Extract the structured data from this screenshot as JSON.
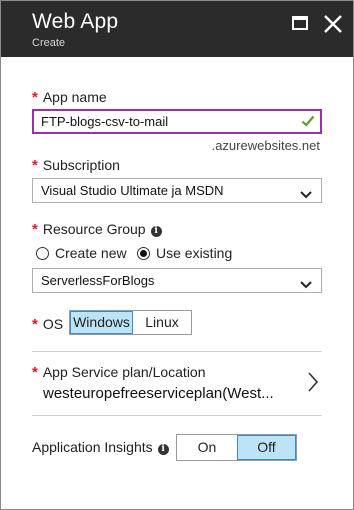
{
  "header": {
    "title": "Web App",
    "subtitle": "Create"
  },
  "icons": {
    "maximize": "maximize-icon",
    "close": "close-icon",
    "check": "check-icon",
    "chevron_down": "chevron-down-icon",
    "chevron_right": "chevron-right-icon",
    "info": "info-icon"
  },
  "required_marker": "*",
  "app_name": {
    "label": "App name",
    "value": "FTP-blogs-csv-to-mail",
    "suffix": ".azurewebsites.net"
  },
  "subscription": {
    "label": "Subscription",
    "value": "Visual Studio Ultimate ja MSDN"
  },
  "resource_group": {
    "label": "Resource Group",
    "info_glyph": "i",
    "options": {
      "create_new": "Create new",
      "use_existing": "Use existing"
    },
    "selected": "use_existing",
    "value": "ServerlessForBlogs"
  },
  "os": {
    "label": "OS",
    "options": [
      "Windows",
      "Linux"
    ],
    "selected": "Windows"
  },
  "app_service_plan": {
    "label": "App Service plan/Location",
    "value": "westeuropefreeserviceplan(West..."
  },
  "app_insights": {
    "label": "Application Insights",
    "info_glyph": "i",
    "options": [
      "On",
      "Off"
    ],
    "selected": "Off"
  },
  "colors": {
    "header_bg": "#2b2b2b",
    "required": "#e81123",
    "focus_border": "#9b2fae",
    "check": "#5aa02c",
    "selected_bg": "#bde3f7",
    "selected_border": "#3a8dc4"
  }
}
